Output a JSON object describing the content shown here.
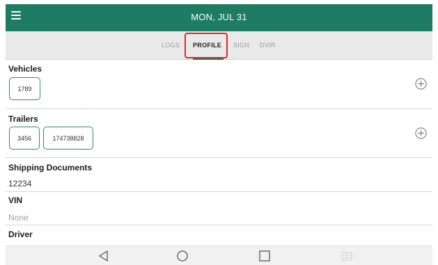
{
  "appbar": {
    "title": "MON, JUL 31",
    "menu_icon": "hamburger-menu-icon"
  },
  "tabs": [
    {
      "label": "LOGS",
      "active": false
    },
    {
      "label": "PROFILE",
      "active": true
    },
    {
      "label": "SIGN",
      "active": false
    },
    {
      "label": "DVIR",
      "active": false
    }
  ],
  "vehicles": {
    "title": "Vehicles",
    "items": [
      "1789"
    ],
    "add_icon": "add-circle-icon"
  },
  "trailers": {
    "title": "Trailers",
    "items": [
      "3456",
      "174738828"
    ],
    "add_icon": "add-circle-icon"
  },
  "shipping_documents": {
    "title": "Shipping Documents",
    "value": "12234"
  },
  "vin": {
    "title": "VIN",
    "value": "None"
  },
  "driver": {
    "title": "Driver"
  },
  "navbar": {
    "back_icon": "back-triangle-icon",
    "home_icon": "home-circle-icon",
    "recents_icon": "recents-square-icon",
    "extra_icon": "keyboard-icon"
  },
  "colors": {
    "accent": "#1d7c63",
    "highlight": "#e0262d",
    "tab_bg": "#e9e9e9"
  }
}
